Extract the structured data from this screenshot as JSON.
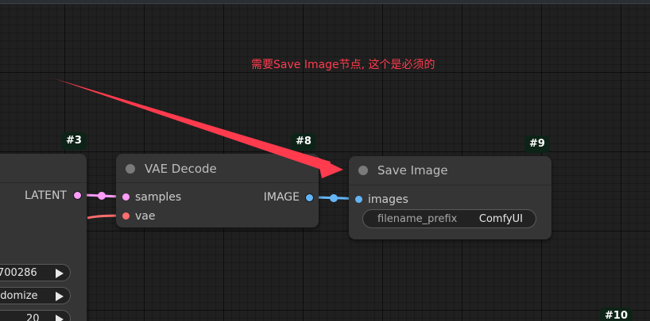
{
  "annotation": {
    "text": "需要Save Image节点, 这个是必须的",
    "color": "#ff3b4d"
  },
  "nodes": {
    "ksampler": {
      "badge": "#3",
      "output_label": "LATENT",
      "widgets": [
        {
          "value": "700286"
        },
        {
          "value": "ndomize"
        },
        {
          "value": "20"
        }
      ]
    },
    "vae_decode": {
      "badge": "#8",
      "title": "VAE Decode",
      "inputs": [
        "samples",
        "vae"
      ],
      "output_label": "IMAGE"
    },
    "save_image": {
      "badge": "#9",
      "title": "Save Image",
      "input": "images",
      "widget": {
        "label": "filename_prefix",
        "value": "ComfyUI"
      }
    },
    "partial": {
      "badge": "#10"
    }
  },
  "colors": {
    "latent": "#ff9cf9",
    "vae": "#ff6e6e",
    "image": "#64b5f6",
    "badge_bg": "#0e2317"
  },
  "icons": [
    "arrow-right-icon",
    "annotation-arrow-icon"
  ]
}
